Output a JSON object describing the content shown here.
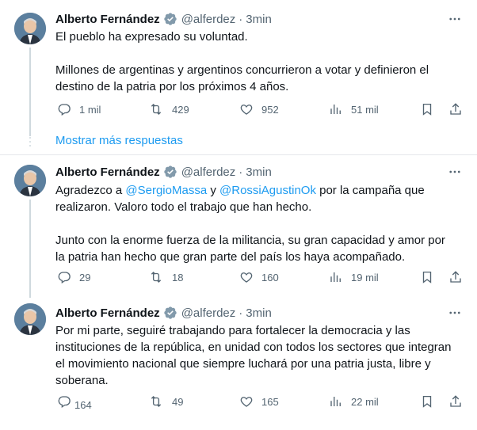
{
  "tweets": [
    {
      "name": "Alberto Fernández",
      "handle": "@alferdez",
      "dot": "·",
      "time": "3min",
      "paragraphs": [
        "El pueblo ha expresado su voluntad.",
        "Millones de argentinas y argentinos concurrieron a votar y definieron el destino de la patria por los próximos 4 años."
      ],
      "replies": "1 mil",
      "retweets": "429",
      "likes": "952",
      "views": "51 mil"
    },
    {
      "name": "Alberto Fernández",
      "handle": "@alferdez",
      "dot": "·",
      "time": "3min",
      "p1_pre": "Agradezco a ",
      "mention1": "@SergioMassa",
      "p1_mid": " y ",
      "mention2": "@RossiAgustinOk",
      "p1_post": " por la campaña que realizaron. Valoro todo el trabajo que han hecho.",
      "p2": "Junto con la enorme fuerza de la militancia, su gran capacidad y amor por la patria han hecho que gran parte del país los haya acompañado.",
      "replies": "29",
      "retweets": "18",
      "likes": "160",
      "views": "19 mil"
    },
    {
      "name": "Alberto Fernández",
      "handle": "@alferdez",
      "dot": "·",
      "time": "3min",
      "paragraphs": [
        "Por mi parte, seguiré trabajando para fortalecer la democracia y las instituciones de la república, en unidad con todos los sectores que integran el movimiento nacional que siempre luchará por una patria justa, libre y soberana."
      ],
      "replies": "164",
      "retweets": "49",
      "likes": "165",
      "views": "22 mil"
    }
  ],
  "show_more": "Mostrar más respuestas",
  "colors": {
    "accent": "#1d9bf0",
    "muted": "#536471",
    "text": "#0f1419"
  },
  "icons": [
    "verified-icon",
    "more-icon",
    "reply-icon",
    "retweet-icon",
    "like-icon",
    "views-icon",
    "bookmark-icon",
    "share-icon"
  ]
}
